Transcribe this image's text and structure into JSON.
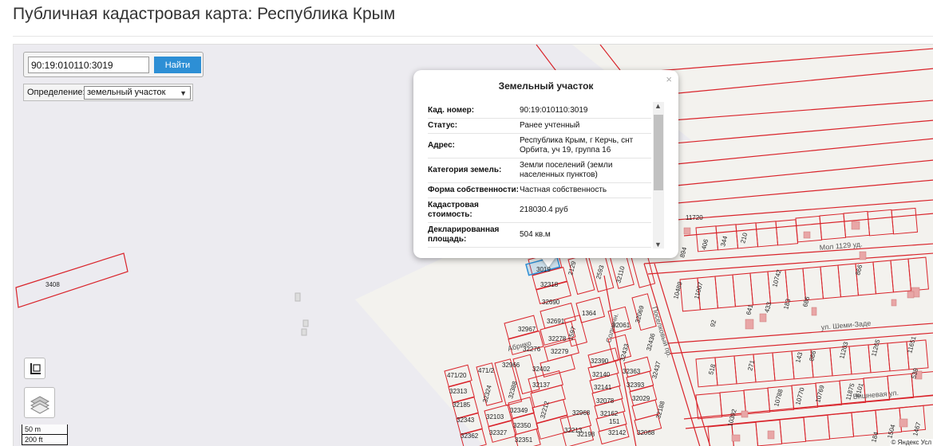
{
  "page": {
    "title": "Публичная кадастровая карта: Республика Крым"
  },
  "search": {
    "value": "90:19:010110:3019",
    "button_label": "Найти"
  },
  "definition": {
    "label": "Определение:",
    "selected": "земельный участок"
  },
  "popup": {
    "title": "Земельный участок",
    "close_glyph": "×",
    "rows": [
      {
        "key": "Кад. номер:",
        "value": "90:19:010110:3019"
      },
      {
        "key": "Статус:",
        "value": "Ранее учтенный"
      },
      {
        "key": "Адрес:",
        "value": "Республика Крым, г Керчь, снт Орбита, уч 19, группа 16"
      },
      {
        "key": "Категория земель:",
        "value": "Земли поселений (земли населенных пунктов)"
      },
      {
        "key": "Форма собственности:",
        "value": "Частная собственность"
      },
      {
        "key": "Кадастровая стоимость:",
        "value": "218030.4 руб"
      },
      {
        "key": "Декларированная площадь:",
        "value": "504 кв.м"
      }
    ]
  },
  "scale": {
    "metric": "50 m",
    "imperial": "200 ft"
  },
  "attribution": "© Яндекс  Усл",
  "colors": {
    "parcel": "#d9232a",
    "building": "#e8a6a6",
    "water": "#ecebf0",
    "land": "#f4f3ef",
    "accent": "#2d8fd5"
  },
  "map": {
    "streets": [
      "ул. Шеми-Заде",
      "Вишневая ул.",
      "Поселковый пр.",
      "Солнечн.",
      "Абрико",
      "Мол 1129 уд."
    ],
    "parcels": [
      "3408",
      "11720",
      "3019",
      "32318",
      "2129",
      "2593",
      "32110",
      "32690",
      "894",
      "406",
      "344",
      "210",
      "10489",
      "11007",
      "10742",
      "866",
      "32691",
      "1364",
      "1597",
      "32061",
      "32069",
      "32436",
      "92",
      "641",
      "433",
      "183",
      "686",
      "32967",
      "32276",
      "32278",
      "32279",
      "32433",
      "518",
      "271",
      "143",
      "886",
      "11203",
      "11265",
      "11651",
      "471/20",
      "471/2",
      "32966",
      "32402",
      "32390",
      "32140",
      "32363",
      "32437",
      "10788",
      "10770",
      "10769",
      "11875",
      "6101",
      "539",
      "32313",
      "32324",
      "32388",
      "32137",
      "32141",
      "32393",
      "10392",
      "1504",
      "1467",
      "32185",
      "32349",
      "32212",
      "32078",
      "32029",
      "32188",
      "32103",
      "32350",
      "32968",
      "32162",
      "32343",
      "32327",
      "32351",
      "32213",
      "32198",
      "32142",
      "32068",
      "32362",
      "151",
      "184"
    ]
  }
}
